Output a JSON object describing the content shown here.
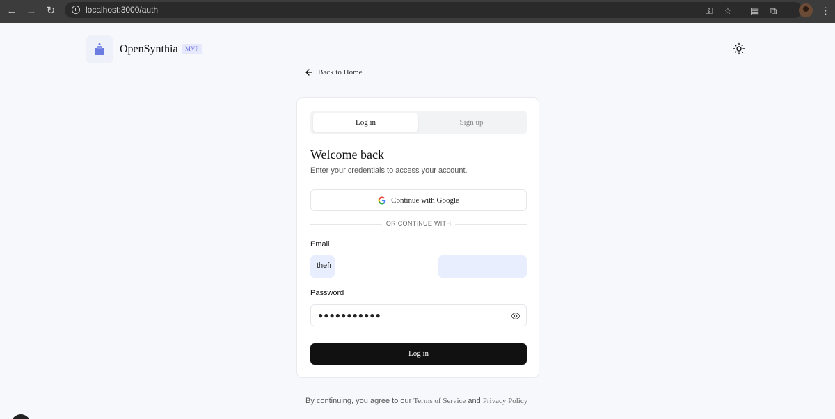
{
  "browser": {
    "url": "localhost:3000/auth"
  },
  "header": {
    "brand": "OpenSynthia",
    "badge": "MVP"
  },
  "back_link": "Back to Home",
  "tabs": [
    {
      "label": "Log in",
      "active": true
    },
    {
      "label": "Sign up",
      "active": false
    }
  ],
  "form": {
    "title": "Welcome back",
    "subtitle": "Enter your credentials to access your account.",
    "google_button": "Continue with Google",
    "divider": "OR CONTINUE WITH",
    "email_label": "Email",
    "email_value": "thefr",
    "password_label": "Password",
    "password_value": "●●●●●●●●●●●",
    "submit_label": "Log in"
  },
  "footer": {
    "prefix": "By continuing, you agree to our ",
    "terms": "Terms of Service",
    "and": " and ",
    "privacy": "Privacy Policy"
  },
  "colors": {
    "primary_button": "#111111",
    "accent": "#6a6fe0",
    "autofill": "#e8eefd"
  }
}
